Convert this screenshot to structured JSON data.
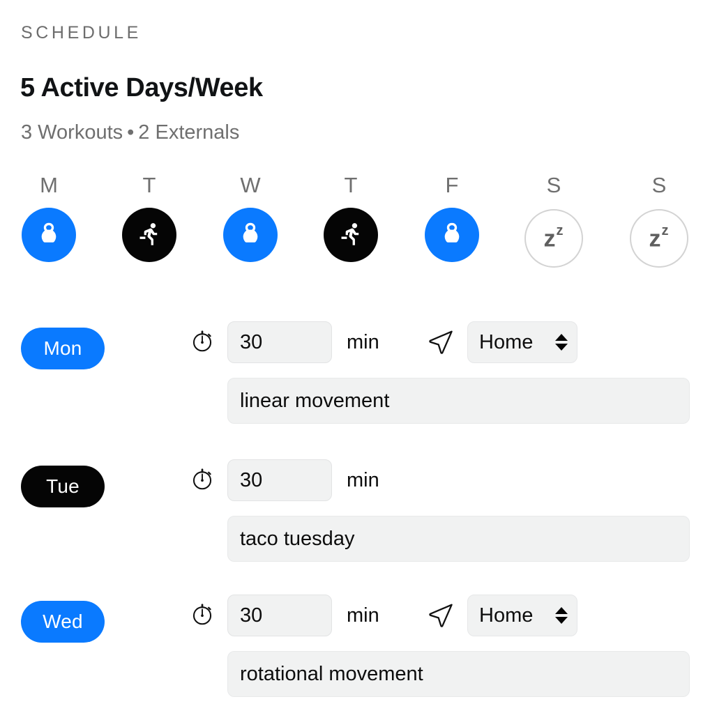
{
  "header": {
    "eyebrow": "SCHEDULE",
    "title": "5 Active Days/Week",
    "subtitle_workouts": "3 Workouts",
    "subtitle_separator": "•",
    "subtitle_externals": "2 Externals"
  },
  "colors": {
    "accent_blue": "#0a7aff",
    "external_black": "#050505",
    "rest_border": "#d3d3d3",
    "field_bg": "#f1f2f2",
    "muted_text": "#6f6f6f"
  },
  "week": {
    "days": [
      {
        "letter": "M",
        "type": "workout",
        "icon": "kettlebell-icon"
      },
      {
        "letter": "T",
        "type": "external",
        "icon": "running-icon"
      },
      {
        "letter": "W",
        "type": "workout",
        "icon": "kettlebell-icon"
      },
      {
        "letter": "T",
        "type": "external",
        "icon": "running-icon"
      },
      {
        "letter": "F",
        "type": "workout",
        "icon": "kettlebell-icon"
      },
      {
        "letter": "S",
        "type": "rest",
        "icon": "sleep-zz-icon",
        "rest_glyph": "z",
        "rest_glyph_sup": "z"
      },
      {
        "letter": "S",
        "type": "rest",
        "icon": "sleep-zz-icon",
        "rest_glyph": "z",
        "rest_glyph_sup": "z"
      }
    ]
  },
  "rows": [
    {
      "day_label": "Mon",
      "day_type": "workout",
      "duration_value": "30",
      "duration_unit": "min",
      "has_location": true,
      "location_value": "Home",
      "note_value": "linear movement"
    },
    {
      "day_label": "Tue",
      "day_type": "external",
      "duration_value": "30",
      "duration_unit": "min",
      "has_location": false,
      "location_value": "",
      "note_value": "taco tuesday"
    },
    {
      "day_label": "Wed",
      "day_type": "workout",
      "duration_value": "30",
      "duration_unit": "min",
      "has_location": true,
      "location_value": "Home",
      "note_value": "rotational movement"
    }
  ]
}
